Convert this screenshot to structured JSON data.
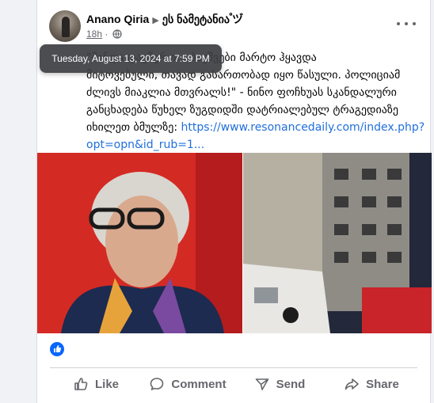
{
  "post": {
    "author": "Anano Qiria",
    "group": "ეს ნამეტანია ゚ヅ",
    "time": "18h",
    "tooltip": "Tuesday, August 13, 2024 at 7:59 PM",
    "text_line1": "\"მინდა დავწერო... ბავშვები მარტო ჰყავდა",
    "text_line2": "მიტოვებული, თავად გასართობად იყო წასული. პოლიციამ",
    "text_line3": "ძლივს მიაკლია მთვრალს!\" - ნინო ფოჩხუას სკანდალური",
    "text_line4": "განცხადება წუხელ ზუგდიდში დატრიალებულ ტრაგედიაზე",
    "text_line5_prefix": "იხილეთ ბმულზე:",
    "link": "https://www.resonancedaily.com/index.php?opt=opn&id_rub=1..."
  },
  "actions": {
    "like": "Like",
    "comment": "Comment",
    "send": "Send",
    "share": "Share"
  },
  "icons": {
    "more": "more-options-icon",
    "privacy": "globe-icon",
    "reaction": "like-reaction-icon"
  },
  "colors": {
    "link": "#216fdb",
    "reaction": "#0866ff",
    "muted": "#65676b"
  }
}
